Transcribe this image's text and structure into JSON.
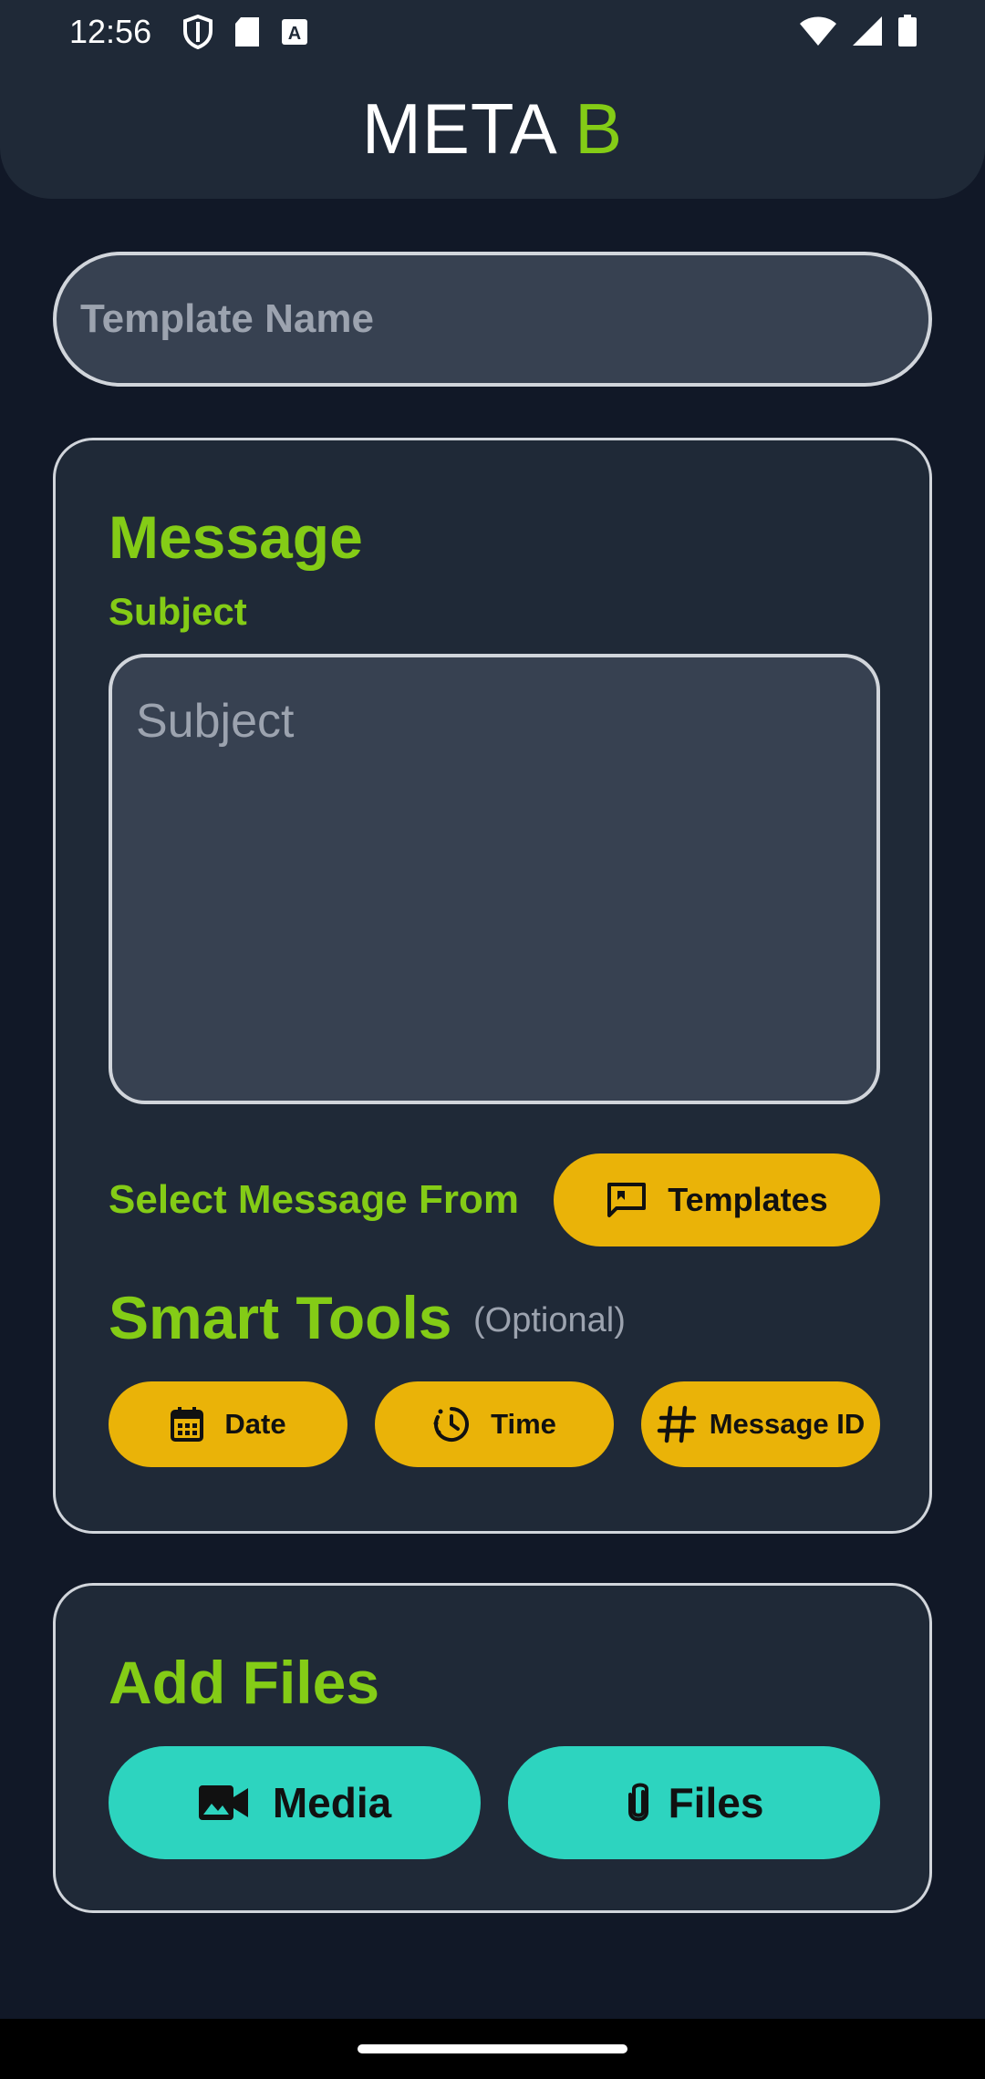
{
  "status_bar": {
    "time": "12:56",
    "left_icons": [
      "shield-icon",
      "sd-card-icon",
      "font-a-icon"
    ],
    "right_icons": [
      "wifi-icon",
      "cellular-signal-icon",
      "battery-icon"
    ]
  },
  "header": {
    "title_main": "META",
    "title_accent": "B"
  },
  "form": {
    "template_name_placeholder": "Template Name",
    "template_name_value": ""
  },
  "message": {
    "title": "Message",
    "subject_label": "Subject",
    "subject_placeholder": "Subject",
    "subject_value": "",
    "select_from_label": "Select Message From",
    "templates_button": "Templates"
  },
  "smart_tools": {
    "title": "Smart Tools",
    "optional_label": "(Optional)",
    "chips": [
      {
        "label": "Date",
        "icon": "calendar-icon"
      },
      {
        "label": "Time",
        "icon": "clock-icon"
      },
      {
        "label": "Message ID",
        "icon": "hash-icon"
      }
    ]
  },
  "add_files": {
    "title": "Add Files",
    "media_button": "Media",
    "files_button": "Files"
  },
  "colors": {
    "background": "#111827",
    "surface": "#1f2937",
    "input": "#374151",
    "accent_green": "#84cc16",
    "accent_yellow": "#eab308",
    "accent_teal": "#2dd4bf"
  }
}
